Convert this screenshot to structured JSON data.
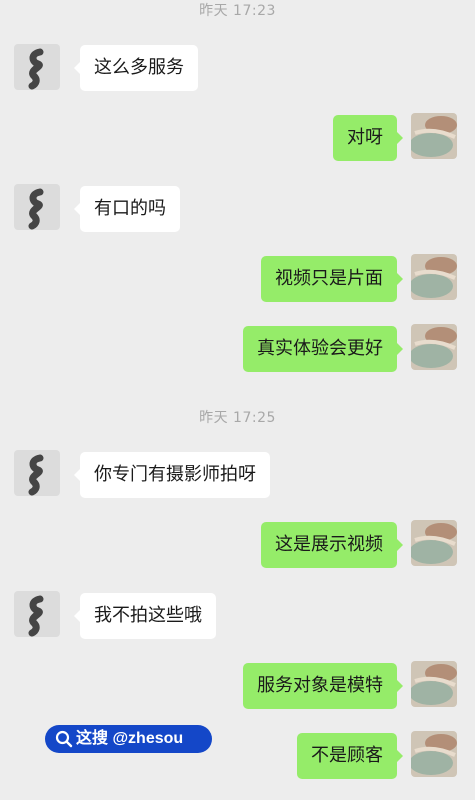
{
  "chat": {
    "timestamps": [
      "昨天 17:23",
      "昨天 17:25"
    ],
    "messages": [
      {
        "side": "in",
        "text": "这么多服务"
      },
      {
        "side": "out",
        "text": "对呀"
      },
      {
        "side": "in",
        "text": "有口的吗"
      },
      {
        "side": "out",
        "text": "视频只是片面"
      },
      {
        "side": "out",
        "text": "真实体验会更好"
      },
      {
        "side": "in",
        "text": "你专门有摄影师拍呀"
      },
      {
        "side": "out",
        "text": "这是展示视频"
      },
      {
        "side": "in",
        "text": "我不拍这些哦"
      },
      {
        "side": "out",
        "text": "服务对象是模特"
      },
      {
        "side": "out",
        "text": "不是顾客"
      }
    ]
  },
  "watermark": {
    "text": "这搜 @zhesou",
    "icon": "search-icon",
    "color": "#1447c8"
  },
  "colors": {
    "background": "#ededed",
    "incoming_bubble": "#ffffff",
    "outgoing_bubble": "#95ec69",
    "timestamp": "#a8a8a8"
  }
}
